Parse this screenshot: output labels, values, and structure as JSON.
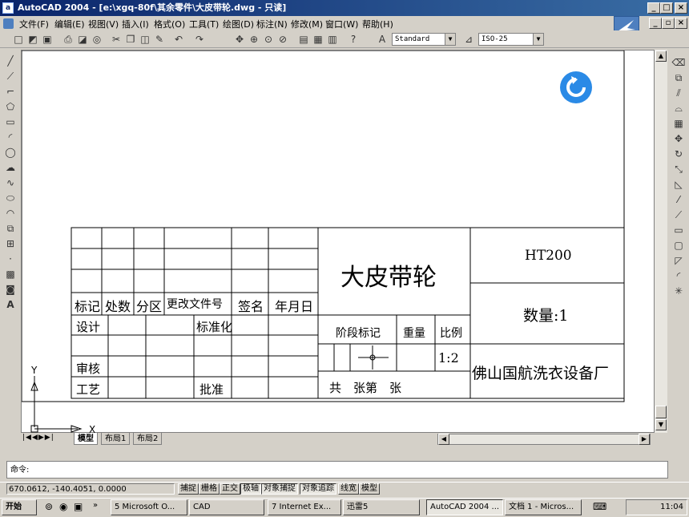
{
  "window": {
    "title": "AutoCAD 2004 - [e:\\xgq-80f\\其余零件\\大皮带轮.dwg - 只读]",
    "min": "_",
    "max": "□",
    "close": "×",
    "doc_min": "_",
    "doc_restore": "▫",
    "doc_close": "×"
  },
  "menu": [
    "文件(F)",
    "编辑(E)",
    "视图(V)",
    "插入(I)",
    "格式(O)",
    "工具(T)",
    "绘图(D)",
    "标注(N)",
    "修改(M)",
    "窗口(W)",
    "帮助(H)"
  ],
  "toolbar": {
    "text_style": "Standard",
    "dim_style": "ISO-25"
  },
  "drawing": {
    "rev_headers": [
      "标记",
      "处数",
      "分区",
      "更改文件号",
      "签名",
      "年月日"
    ],
    "design": "设计",
    "standardize": "标准化",
    "review": "审核",
    "craft": "工艺",
    "approve": "批准",
    "part_name": "大皮带轮",
    "material": "HT200",
    "quantity": "数量:1",
    "stage_mark": "阶段标记",
    "weight": "重量",
    "scale_label": "比例",
    "scale_value": "1:2",
    "sheet": "共　张第　张",
    "company": "佛山国航洗衣设备厂",
    "ucs_x": "X",
    "ucs_y": "Y"
  },
  "layout_tabs": [
    "模型",
    "布局1",
    "布局2"
  ],
  "command": {
    "prompt": "命令:"
  },
  "status": {
    "coords": "670.0612, -140.4051, 0.0000",
    "buttons": [
      "捕捉",
      "栅格",
      "正交",
      "极轴",
      "对象捕捉",
      "对象追踪",
      "线宽",
      "模型"
    ]
  },
  "taskbar": {
    "start": "开始",
    "items": [
      "5 Microsoft O...",
      "CAD",
      "7 Internet Ex...",
      "迅雷5",
      "AutoCAD 2004 ...",
      "文档 1 - Micros..."
    ],
    "clock": "11:04"
  }
}
